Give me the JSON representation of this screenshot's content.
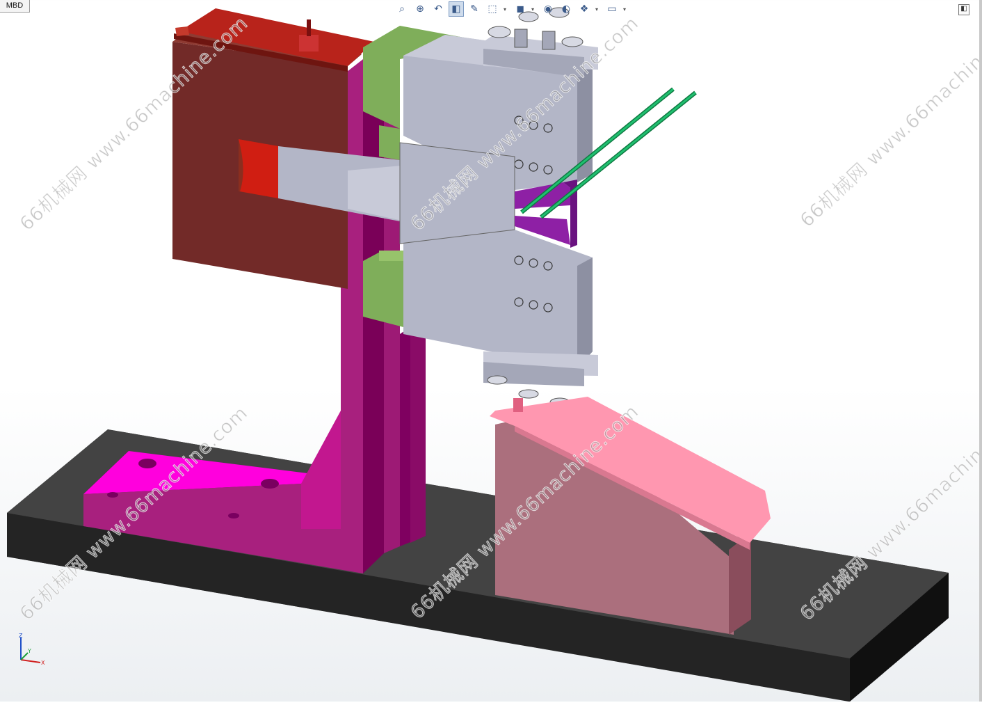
{
  "tabs": {
    "mbd_label": "MBD"
  },
  "toolbar": {
    "buttons": [
      {
        "name": "zoom-to-fit-icon",
        "glyph": "⌕"
      },
      {
        "name": "zoom-to-area-icon",
        "glyph": "⊕"
      },
      {
        "name": "previous-view-icon",
        "glyph": "↶"
      },
      {
        "name": "section-view-icon",
        "glyph": "◧"
      },
      {
        "name": "dynamic-annotation-icon",
        "glyph": "✎"
      },
      {
        "name": "view-orientation-icon",
        "glyph": "⬚"
      },
      {
        "name": "display-style-icon",
        "glyph": "◼"
      },
      {
        "name": "hide-show-items-icon",
        "glyph": "◉"
      },
      {
        "name": "edit-appearance-icon",
        "glyph": "◐"
      },
      {
        "name": "apply-scene-icon",
        "glyph": "❖"
      },
      {
        "name": "view-settings-icon",
        "glyph": "▭"
      }
    ]
  },
  "panel_toggle_glyph": "◧",
  "watermark": {
    "url": "www.66machine.com",
    "brand": "66机械网"
  },
  "triad": {
    "x": "X",
    "y": "Y",
    "z": "Z"
  },
  "colors": {
    "base_plate": "#3a3a3a",
    "bracket": "#ff00dd",
    "column": "#a8207e",
    "heater_block": "#722a28",
    "top_rail": "#b8231b",
    "spacer": "#7fae5a",
    "clamp_block": "#b3b6c7",
    "die_insert": "#8e20a5",
    "wire": "#1aa85e",
    "chute": "#ab6f7d",
    "chute_lip": "#ff97b0"
  }
}
